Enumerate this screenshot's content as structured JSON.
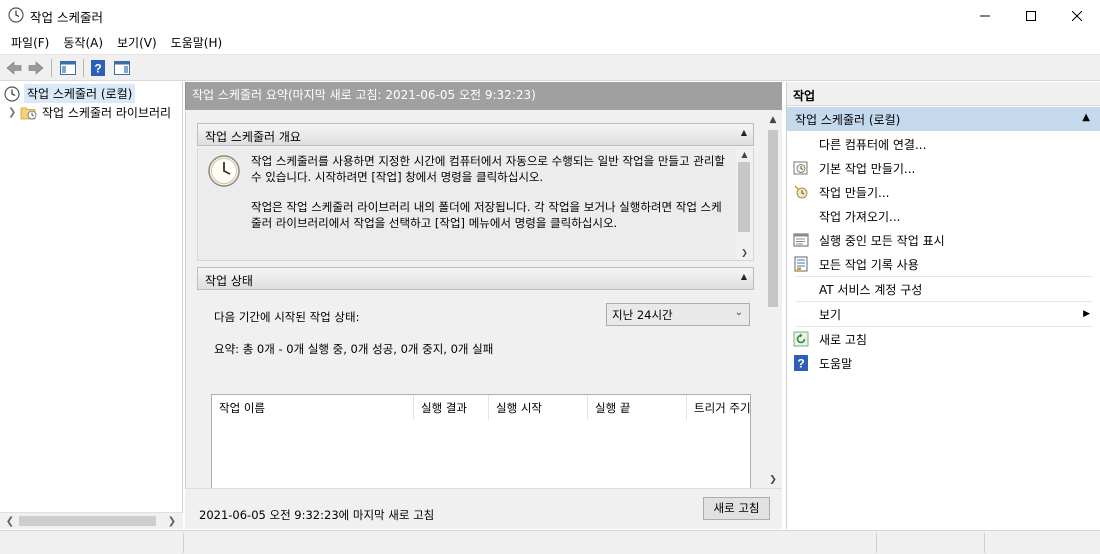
{
  "window": {
    "title": "작업 스케줄러",
    "icon": "clock-icon"
  },
  "menu": [
    {
      "label": "파일(F)"
    },
    {
      "label": "동작(A)"
    },
    {
      "label": "보기(V)"
    },
    {
      "label": "도움말(H)"
    }
  ],
  "toolbar": {
    "icons": [
      "back-arrow-icon",
      "forward-arrow-icon",
      "show-hide-tree-icon",
      "help-icon",
      "show-hide-action-pane-icon"
    ]
  },
  "tree": {
    "root": "작업 스케줄러 (로컬)",
    "child": "작업 스케줄러 라이브러리"
  },
  "center": {
    "header": "작업 스케줄러 요약(마지막 새로 고침: 2021-06-05 오전 9:32:23)",
    "overview": {
      "title": "작업 스케줄러 개요",
      "para1": "작업 스케줄러를 사용하면 지정한 시간에 컴퓨터에서 자동으로 수행되는 일반 작업을 만들고 관리할 수 있습니다. 시작하려면 [작업] 창에서 명령을 클릭하십시오.",
      "para2": "작업은 작업 스케줄러 라이브러리 내의 폴더에 저장됩니다. 각 작업을 보거나 실행하려면 작업 스케줄러 라이브러리에서 작업을 선택하고 [작업] 메뉴에서 명령을 클릭하십시오."
    },
    "status": {
      "title": "작업 상태",
      "label": "다음 기간에 시작된 작업 상태:",
      "period": "지난 24시간",
      "summary": "요약: 총 0개 - 0개 실행 중, 0개 성공, 0개 중지, 0개 실패",
      "columns": [
        "작업 이름",
        "실행 결과",
        "실행 시작",
        "실행 끝",
        "트리거 주기"
      ]
    },
    "footer": {
      "refresh_info": "2021-06-05 오전 9:32:23에 마지막 새로 고침",
      "refresh_button": "새로 고침"
    }
  },
  "actions": {
    "title": "작업",
    "group": "작업 스케줄러 (로컬)",
    "items": [
      {
        "label": "다른 컴퓨터에 연결...",
        "icon": ""
      },
      {
        "label": "기본 작업 만들기...",
        "icon": "basic-task-icon"
      },
      {
        "label": "작업 만들기...",
        "icon": "create-task-icon"
      },
      {
        "label": "작업 가져오기...",
        "icon": ""
      },
      {
        "label": "실행 중인 모든 작업 표시",
        "icon": "running-tasks-icon"
      },
      {
        "label": "모든 작업 기록 사용",
        "icon": "history-icon"
      },
      {
        "label": "AT 서비스 계정 구성",
        "icon": ""
      },
      {
        "label": "보기",
        "icon": ""
      },
      {
        "label": "새로 고침",
        "icon": "refresh-icon"
      },
      {
        "label": "도움말",
        "icon": "help-icon"
      }
    ]
  }
}
